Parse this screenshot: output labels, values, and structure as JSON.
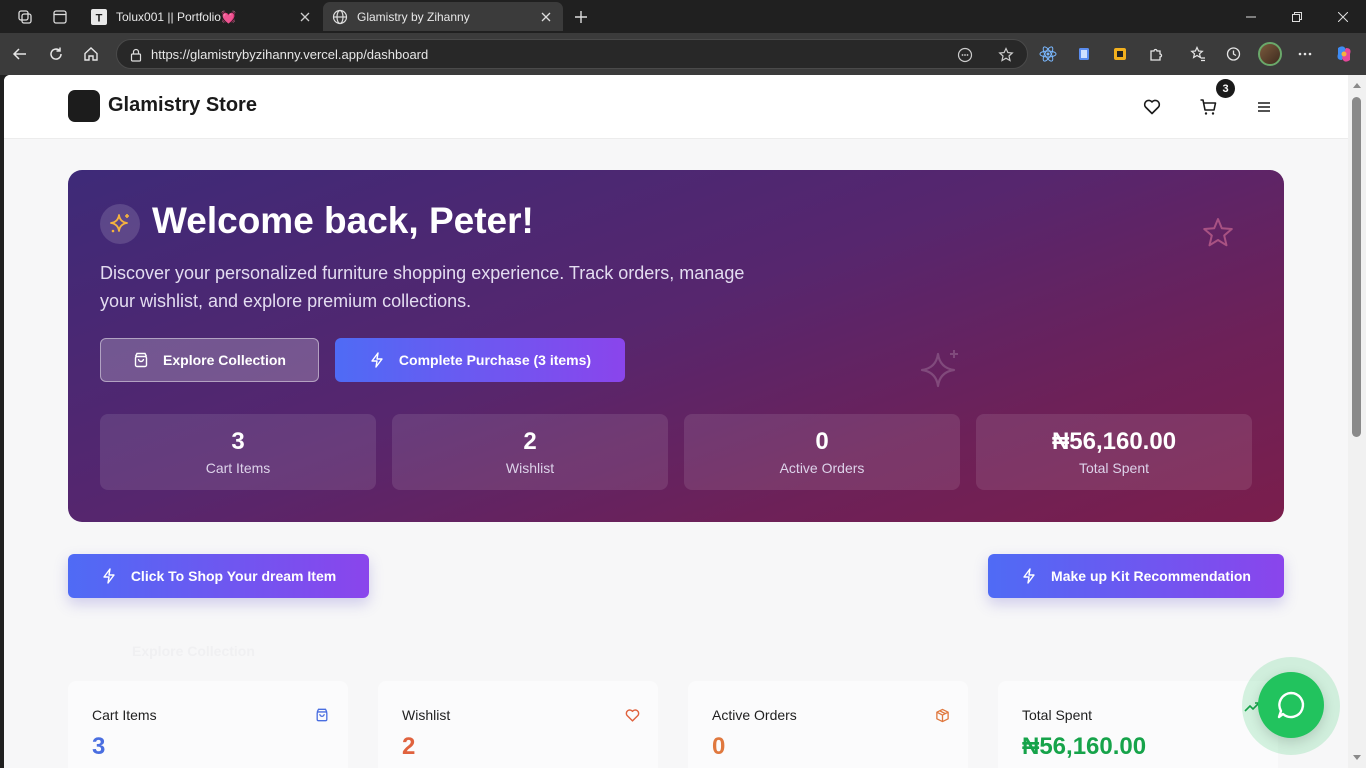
{
  "browser": {
    "tabs": [
      {
        "title": "Tolux001 || Portfolio💓",
        "favicon": "T",
        "active": false
      },
      {
        "title": "Glamistry by Zihanny",
        "favicon": "globe-icon",
        "active": true
      }
    ],
    "url": "https://glamistrybyzihanny.vercel.app/dashboard"
  },
  "header": {
    "store_name": "Glamistry Store",
    "cart_count": "3"
  },
  "hero": {
    "title": "Welcome back, Peter!",
    "subtitle": "Discover your personalized furniture shopping experience. Track orders, manage your wishlist, and explore premium collections.",
    "explore_label": "Explore Collection",
    "complete_label": "Complete Purchase (3 items)",
    "stats": [
      {
        "value": "3",
        "label": "Cart Items"
      },
      {
        "value": "2",
        "label": "Wishlist"
      },
      {
        "value": "0",
        "label": "Active Orders"
      },
      {
        "value": "₦56,160.00",
        "label": "Total Spent"
      }
    ]
  },
  "actions": {
    "shop_label": "Click To Shop Your dream Item",
    "makeup_label": "Make up Kit Recommendation",
    "ghost_label": "Explore Collection"
  },
  "cards": [
    {
      "title": "Cart Items",
      "value": "3",
      "color": "#4a6ee0",
      "icon": "shopping-bag-icon"
    },
    {
      "title": "Wishlist",
      "value": "2",
      "color": "#e0623e",
      "icon": "heart-icon"
    },
    {
      "title": "Active Orders",
      "value": "0",
      "color": "#e0783e",
      "icon": "package-icon"
    },
    {
      "title": "Total Spent",
      "value": "₦56,160.00",
      "color": "#16a34a",
      "icon": "trending-up-icon"
    }
  ],
  "colors": {
    "accent_start": "#4f6bf5",
    "accent_end": "#8a45ec",
    "whatsapp": "#22c35e"
  }
}
